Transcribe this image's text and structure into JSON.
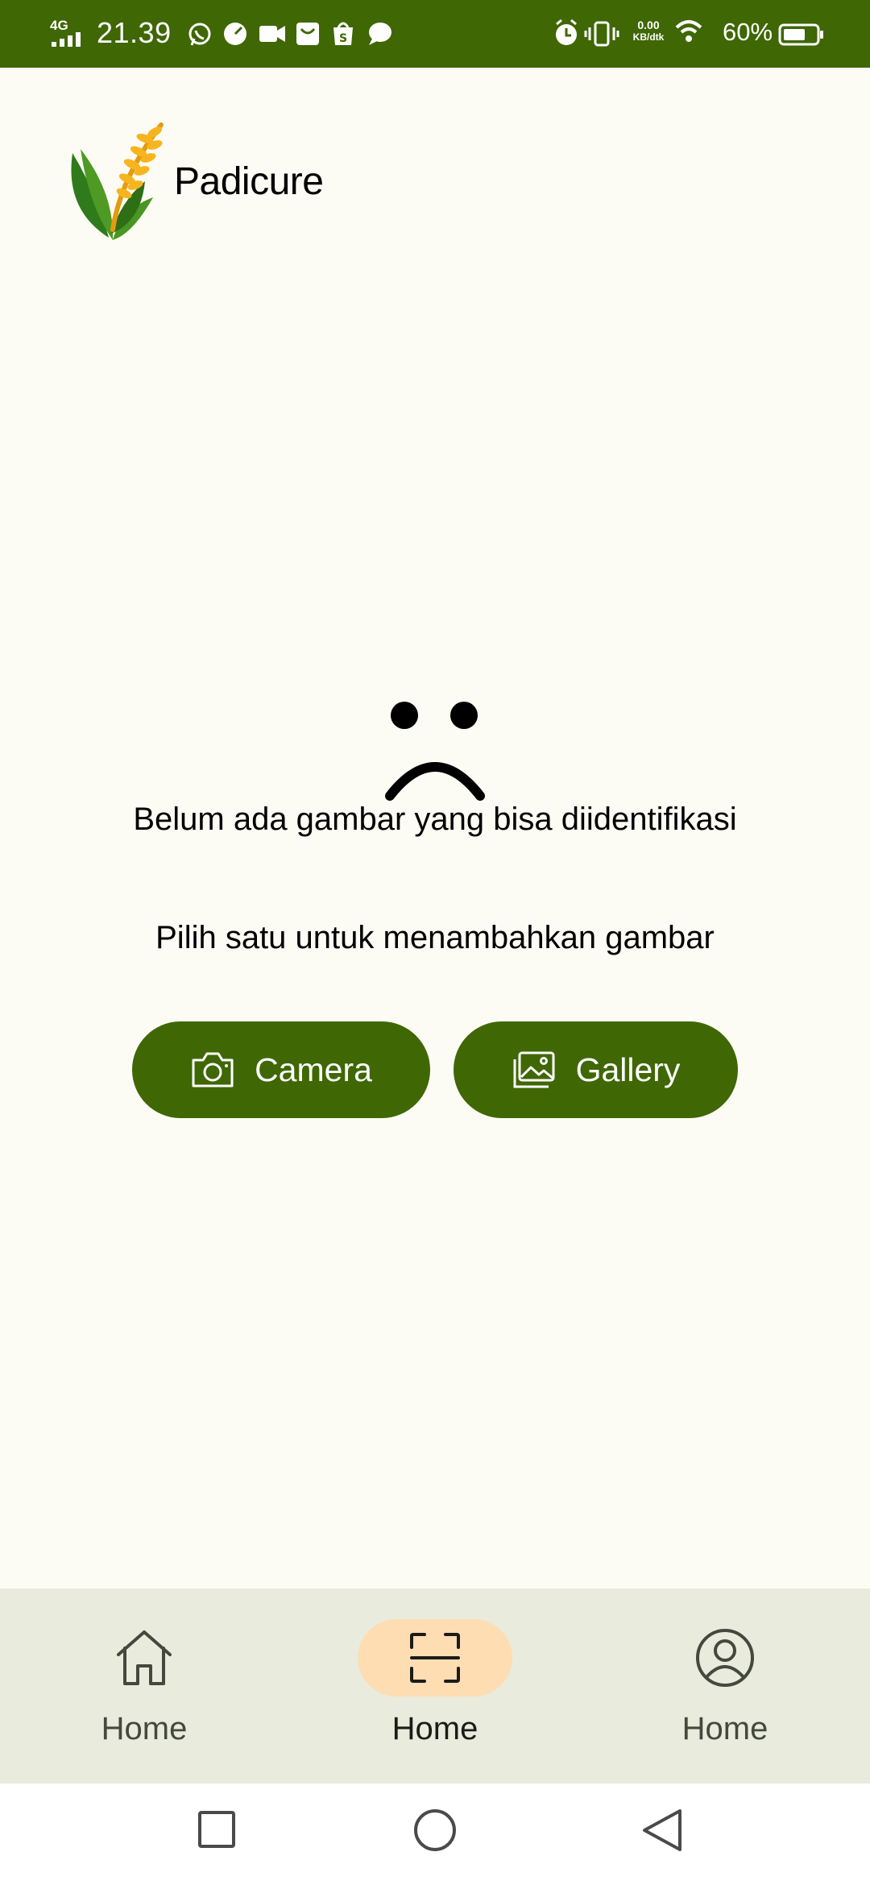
{
  "status_bar": {
    "network": "4G",
    "time": "21.39",
    "speed_value": "0.00",
    "speed_unit": "KB/dtk",
    "battery": "60%",
    "background": "#3F6704"
  },
  "app": {
    "title": "Padicure",
    "logo_icon": "rice-plant-icon"
  },
  "empty_state": {
    "icon": "sad-face-icon",
    "title": "Belum ada gambar yang bisa diidentifikasi",
    "hint": "Pilih satu untuk menambahkan gambar"
  },
  "actions": {
    "camera_label": "Camera",
    "camera_icon": "camera-icon",
    "gallery_label": "Gallery",
    "gallery_icon": "gallery-icon",
    "color": "#3F6704"
  },
  "bottom_nav": {
    "items": [
      {
        "label": "Home",
        "icon": "home-icon",
        "active": false
      },
      {
        "label": "Home",
        "icon": "scan-icon",
        "active": true
      },
      {
        "label": "Home",
        "icon": "profile-icon",
        "active": false
      }
    ],
    "active_indicator_color": "#FFDDB3"
  }
}
